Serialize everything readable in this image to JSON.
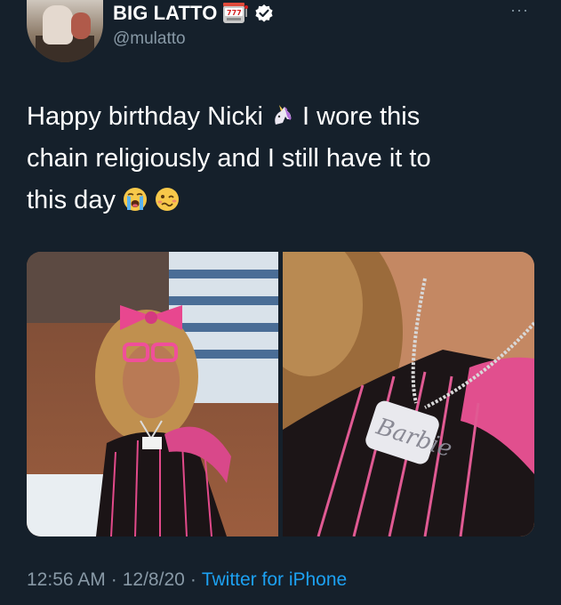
{
  "header": {
    "display_name": "BIG LATTO",
    "handle": "@mulatto",
    "more_label": "···"
  },
  "tweet": {
    "line1_before_emoji": "Happy birthday Nicki ",
    "line1_after_emoji": " I wore this",
    "line2": "chain religiously and I still have it to",
    "line3": "this day ",
    "emojis": [
      "unicorn-emoji",
      "loudly-crying-face-emoji",
      "woozy-face-emoji"
    ]
  },
  "media": {
    "photo_left": "photo-girl-pink-bow",
    "photo_right": "photo-barbie-chain-closeup"
  },
  "meta": {
    "time": "12:56 AM",
    "separator1": "·",
    "date": "12/8/20",
    "separator2": "·",
    "source": "Twitter for iPhone"
  },
  "colors": {
    "background": "#15202b",
    "secondary_text": "#8899a6",
    "link": "#1da1f2",
    "verified": "#ffffff"
  }
}
